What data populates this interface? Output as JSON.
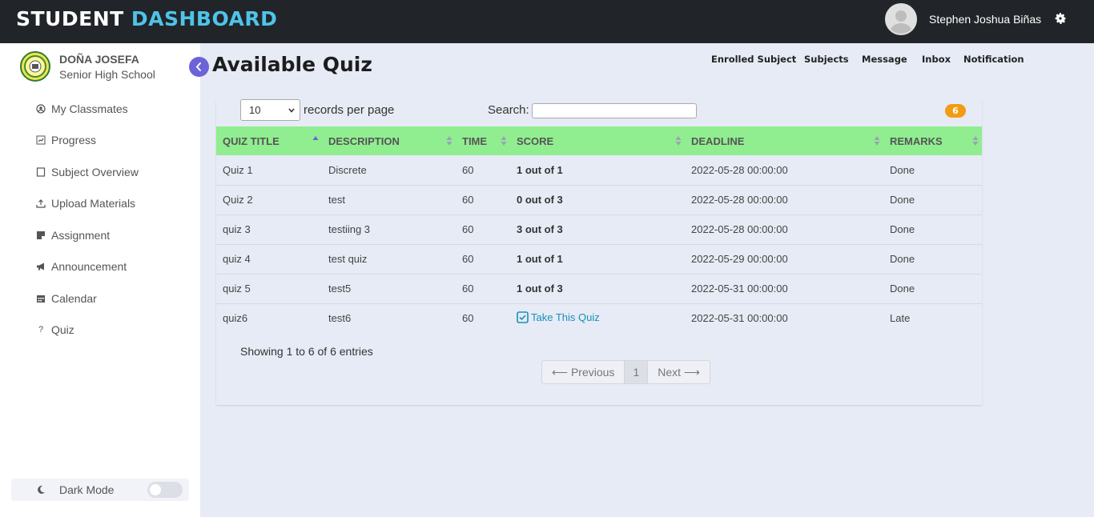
{
  "header": {
    "brand_part1": "STUDENT ",
    "brand_part2": "DASHBOARD",
    "user_name": "Stephen Joshua Biñas",
    "brand_accent_color": "#4fc3e8"
  },
  "sidebar": {
    "school_line1": "DOÑA JOSEFA",
    "school_line2": "Senior High School",
    "items": [
      {
        "label": "My Classmates",
        "icon": "user-circle-icon"
      },
      {
        "label": "Progress",
        "icon": "chart-icon"
      },
      {
        "label": "Subject Overview",
        "icon": "book-icon"
      },
      {
        "label": "Upload Materials",
        "icon": "upload-icon"
      },
      {
        "label": "Assignment",
        "icon": "sticky-note-icon"
      },
      {
        "label": "Announcement",
        "icon": "megaphone-icon"
      },
      {
        "label": "Calendar",
        "icon": "calendar-icon"
      },
      {
        "label": "Quiz",
        "icon": "question-icon"
      }
    ],
    "dark_mode_label": "Dark Mode",
    "dark_mode_on": false
  },
  "main": {
    "title": "Available Quiz",
    "top_nav": [
      "Enrolled Subject",
      "Subjects",
      "Message",
      "Inbox",
      "Notification"
    ],
    "records_per_page": "10",
    "records_per_page_label": "records per page",
    "search_label": "Search:",
    "search_value": "",
    "count_badge": "6",
    "columns": [
      "QUIZ TITLE",
      "DESCRIPTION",
      "TIME",
      "SCORE",
      "DEADLINE",
      "REMARKS"
    ],
    "header_color": "#90ee90",
    "rows": [
      {
        "title": "Quiz 1",
        "description": "Discrete",
        "time": "60",
        "score": "1 out of 1",
        "deadline": "2022-05-28 00:00:00",
        "remarks": "Done"
      },
      {
        "title": "Quiz 2",
        "description": "test",
        "time": "60",
        "score": "0 out of 3",
        "deadline": "2022-05-28 00:00:00",
        "remarks": "Done"
      },
      {
        "title": "quiz 3",
        "description": "testiing 3",
        "time": "60",
        "score": "3 out of 3",
        "deadline": "2022-05-28 00:00:00",
        "remarks": "Done"
      },
      {
        "title": "quiz 4",
        "description": "test quiz",
        "time": "60",
        "score": "1 out of 1",
        "deadline": "2022-05-29 00:00:00",
        "remarks": "Done"
      },
      {
        "title": "quiz 5",
        "description": "test5",
        "time": "60",
        "score": "1 out of 3",
        "deadline": "2022-05-31 00:00:00",
        "remarks": "Done"
      },
      {
        "title": "quiz6",
        "description": "test6",
        "time": "60",
        "score": "Take This Quiz",
        "deadline": "2022-05-31 00:00:00",
        "remarks": "Late"
      }
    ],
    "info": "Showing 1 to 6 of 6 entries",
    "pager": {
      "prev": "⟵ Previous",
      "page": "1",
      "next": "Next ⟶"
    }
  }
}
